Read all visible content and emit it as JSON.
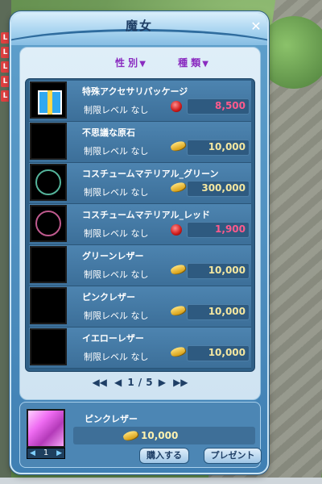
{
  "window": {
    "title": "魔女"
  },
  "filters": {
    "gender_label": "性 別",
    "type_label": "種 類"
  },
  "items": [
    {
      "name": "特殊アクセサリパッケージ",
      "level": "制限レベル なし",
      "currency": "gem",
      "price": "8,500",
      "swatch": "gift"
    },
    {
      "name": "不思議な原石",
      "level": "制限レベル なし",
      "currency": "coin",
      "price": "10,000",
      "swatch": "stone"
    },
    {
      "name": "コスチュームマテリアル_グリーン",
      "level": "制限レベル なし",
      "currency": "coin",
      "price": "300,000",
      "swatch": "circle-g"
    },
    {
      "name": "コスチュームマテリアル_レッド",
      "level": "制限レベル なし",
      "currency": "gem",
      "price": "1,900",
      "swatch": "circle-r"
    },
    {
      "name": "グリーンレザー",
      "level": "制限レベル なし",
      "currency": "coin",
      "price": "10,000",
      "swatch": "green"
    },
    {
      "name": "ピンクレザー",
      "level": "制限レベル なし",
      "currency": "coin",
      "price": "10,000",
      "swatch": "pink"
    },
    {
      "name": "イエローレザー",
      "level": "制限レベル なし",
      "currency": "coin",
      "price": "10,000",
      "swatch": "yellow"
    }
  ],
  "pagination": {
    "current": "1",
    "separator": "/",
    "total": "5"
  },
  "selected": {
    "name": "ピンクレザー",
    "price": "10,000",
    "quantity": "1"
  },
  "buttons": {
    "buy": "購入する",
    "present": "プレゼント"
  },
  "colors": {
    "accent_purple": "#8a2cc0",
    "price_red": "#ff5a8c",
    "price_gold": "#f4e7a0"
  }
}
